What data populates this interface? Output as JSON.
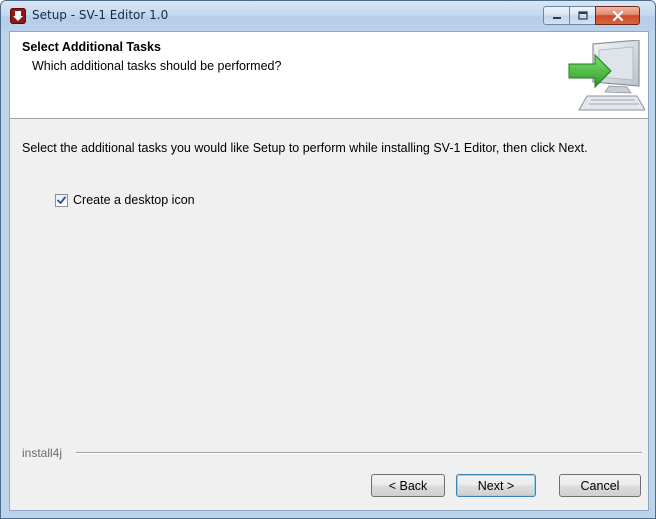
{
  "window": {
    "title": "Setup - SV-1 Editor 1.0",
    "controls": {
      "minimize": "minimize",
      "maximize": "maximize",
      "close": "close"
    }
  },
  "header": {
    "title": "Select Additional Tasks",
    "subtitle": "Which additional tasks should be performed?",
    "graphic": "computer-with-arrow-icon"
  },
  "body": {
    "instructions": "Select the additional tasks you would like Setup to perform while installing SV-1 Editor, then click Next.",
    "tasks": [
      {
        "label": "Create a desktop icon",
        "checked": true
      }
    ]
  },
  "footer": {
    "brand": "install4j",
    "buttons": {
      "back": "< Back",
      "next": "Next >",
      "cancel": "Cancel"
    }
  },
  "colors": {
    "title_bar": "#bcd3ea",
    "close_button": "#cd4a2a",
    "content_bg": "#f0f0f0",
    "header_bg": "#ffffff",
    "default_button_border": "#3c7fb1"
  }
}
